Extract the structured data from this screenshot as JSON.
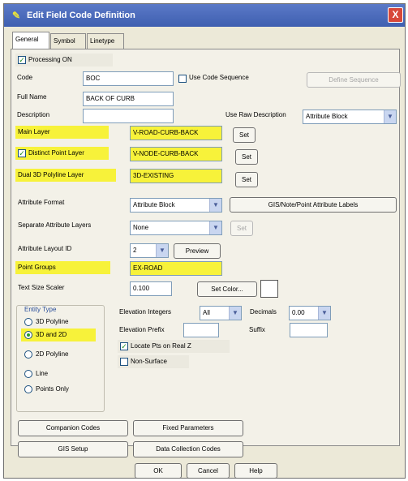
{
  "window": {
    "title": "Edit Field Code Definition",
    "close_glyph": "X"
  },
  "tabs": [
    {
      "label": "General",
      "active": true
    },
    {
      "label": "Symbol",
      "active": false
    },
    {
      "label": "Linetype",
      "active": false
    }
  ],
  "processing_on": {
    "label": "Processing ON",
    "checked": true
  },
  "code": {
    "label": "Code",
    "value": "BOC"
  },
  "use_code_sequence": {
    "label": "Use Code Sequence",
    "checked": false
  },
  "define_sequence_button": "Define Sequence",
  "full_name": {
    "label": "Full Name",
    "value": "BACK OF CURB"
  },
  "description": {
    "label": "Description",
    "value": ""
  },
  "use_raw_description": {
    "label": "Use Raw Description",
    "value": "Attribute Block"
  },
  "main_layer": {
    "label": "Main Layer",
    "value": "V-ROAD-CURB-BACK",
    "set": "Set"
  },
  "distinct_point_layer": {
    "label": "Distinct Point Layer",
    "checked": true,
    "value": "V-NODE-CURB-BACK",
    "set": "Set"
  },
  "dual_3d_polyline_layer": {
    "label": "Dual 3D Polyline Layer",
    "value": "3D-EXISTING",
    "set": "Set"
  },
  "attribute_format": {
    "label": "Attribute Format",
    "value": "Attribute Block"
  },
  "gis_note_button": "GIS/Note/Point Attribute Labels",
  "separate_attribute_layers": {
    "label": "Separate Attribute Layers",
    "value": "None",
    "set": "Set"
  },
  "attribute_layout_id": {
    "label": "Attribute Layout ID",
    "value": "2",
    "preview": "Preview"
  },
  "point_groups": {
    "label": "Point Groups",
    "value": "EX-ROAD"
  },
  "text_size_scaler": {
    "label": "Text Size Scaler",
    "value": "0.100",
    "set_color": "Set Color..."
  },
  "entity_type": {
    "label": "Entity Type",
    "options": [
      {
        "label": "3D Polyline",
        "selected": false
      },
      {
        "label": "3D and 2D",
        "selected": true
      },
      {
        "label": "2D Polyline",
        "selected": false
      },
      {
        "label": "Line",
        "selected": false
      },
      {
        "label": "Points Only",
        "selected": false
      }
    ]
  },
  "elevation_integers": {
    "label": "Elevation Integers",
    "value": "All"
  },
  "decimals": {
    "label": "Decimals",
    "value": "0.00"
  },
  "elevation_prefix": {
    "label": "Elevation Prefix",
    "value": ""
  },
  "suffix": {
    "label": "Suffix",
    "value": ""
  },
  "locate_pts_on_real_z": {
    "label": "Locate Pts on Real Z",
    "checked": true
  },
  "non_surface": {
    "label": "Non-Surface",
    "checked": false
  },
  "companion_codes_button": "Companion Codes",
  "fixed_parameters_button": "Fixed Parameters",
  "gis_setup_button": "GIS Setup",
  "data_collection_codes_button": "Data Collection Codes",
  "ok_button": "OK",
  "cancel_button": "Cancel",
  "help_button": "Help",
  "colors": {
    "highlight": "#f7f23a",
    "titlebar": "#4a68ba",
    "dialog": "#ece9d8"
  }
}
